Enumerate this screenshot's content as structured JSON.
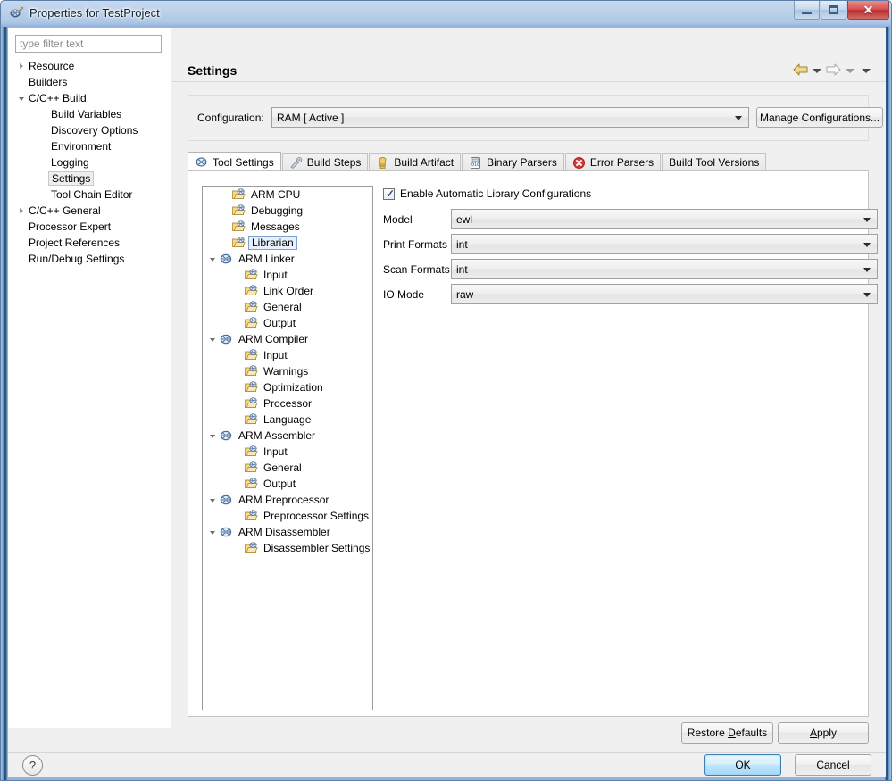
{
  "window": {
    "title": "Properties for TestProject",
    "icon": "eclipse-project-icon",
    "controls": {
      "minimize": "minimize-icon",
      "restore": "restore-icon",
      "close": "close-icon",
      "close_glyph": "✕"
    }
  },
  "filter": {
    "placeholder": "type filter text",
    "value": ""
  },
  "sidebar": {
    "items": [
      {
        "label": "Resource",
        "indent": 0,
        "arrow": "closed",
        "selected": false
      },
      {
        "label": "Builders",
        "indent": 0,
        "arrow": "none",
        "selected": false
      },
      {
        "label": "C/C++ Build",
        "indent": 0,
        "arrow": "open",
        "selected": false
      },
      {
        "label": "Build Variables",
        "indent": 1,
        "arrow": "none",
        "selected": false
      },
      {
        "label": "Discovery Options",
        "indent": 1,
        "arrow": "none",
        "selected": false
      },
      {
        "label": "Environment",
        "indent": 1,
        "arrow": "none",
        "selected": false
      },
      {
        "label": "Logging",
        "indent": 1,
        "arrow": "none",
        "selected": false
      },
      {
        "label": "Settings",
        "indent": 1,
        "arrow": "none",
        "selected": true
      },
      {
        "label": "Tool Chain Editor",
        "indent": 1,
        "arrow": "none",
        "selected": false
      },
      {
        "label": "C/C++ General",
        "indent": 0,
        "arrow": "closed",
        "selected": false
      },
      {
        "label": "Processor Expert",
        "indent": 0,
        "arrow": "none",
        "selected": false
      },
      {
        "label": "Project References",
        "indent": 0,
        "arrow": "none",
        "selected": false
      },
      {
        "label": "Run/Debug Settings",
        "indent": 0,
        "arrow": "none",
        "selected": false
      }
    ]
  },
  "header": {
    "title": "Settings",
    "back_icon": "back-arrow-icon",
    "forward_icon": "forward-arrow-icon",
    "menu_icon": "dropdown-caret-icon"
  },
  "configuration": {
    "label": "Configuration:",
    "value": "RAM  [ Active ]",
    "manage_button": "Manage Configurations..."
  },
  "tabs": [
    {
      "label": "Tool Settings",
      "icon": "tool-settings-icon",
      "active": true
    },
    {
      "label": "Build Steps",
      "icon": "build-steps-icon",
      "active": false
    },
    {
      "label": "Build Artifact",
      "icon": "build-artifact-icon",
      "active": false
    },
    {
      "label": "Binary Parsers",
      "icon": "binary-parsers-icon",
      "active": false
    },
    {
      "label": "Error Parsers",
      "icon": "error-parsers-icon",
      "active": false
    },
    {
      "label": "Build Tool Versions",
      "icon": "",
      "active": false
    }
  ],
  "tool_tree": [
    {
      "label": "ARM CPU",
      "indent": 1,
      "arrow": "none",
      "icon": "tool-folder-icon",
      "selected": false
    },
    {
      "label": "Debugging",
      "indent": 1,
      "arrow": "none",
      "icon": "tool-folder-icon",
      "selected": false
    },
    {
      "label": "Messages",
      "indent": 1,
      "arrow": "none",
      "icon": "tool-folder-icon",
      "selected": false
    },
    {
      "label": "Librarian",
      "indent": 1,
      "arrow": "none",
      "icon": "tool-folder-icon",
      "selected": true
    },
    {
      "label": "ARM Linker",
      "indent": 0,
      "arrow": "open",
      "icon": "tool-node-icon",
      "selected": false
    },
    {
      "label": "Input",
      "indent": 2,
      "arrow": "none",
      "icon": "tool-folder-icon",
      "selected": false
    },
    {
      "label": "Link Order",
      "indent": 2,
      "arrow": "none",
      "icon": "tool-folder-icon",
      "selected": false
    },
    {
      "label": "General",
      "indent": 2,
      "arrow": "none",
      "icon": "tool-folder-icon",
      "selected": false
    },
    {
      "label": "Output",
      "indent": 2,
      "arrow": "none",
      "icon": "tool-folder-icon",
      "selected": false
    },
    {
      "label": "ARM Compiler",
      "indent": 0,
      "arrow": "open",
      "icon": "tool-node-icon",
      "selected": false
    },
    {
      "label": "Input",
      "indent": 2,
      "arrow": "none",
      "icon": "tool-folder-icon",
      "selected": false
    },
    {
      "label": "Warnings",
      "indent": 2,
      "arrow": "none",
      "icon": "tool-folder-icon",
      "selected": false
    },
    {
      "label": "Optimization",
      "indent": 2,
      "arrow": "none",
      "icon": "tool-folder-icon",
      "selected": false
    },
    {
      "label": "Processor",
      "indent": 2,
      "arrow": "none",
      "icon": "tool-folder-icon",
      "selected": false
    },
    {
      "label": "Language",
      "indent": 2,
      "arrow": "none",
      "icon": "tool-folder-icon",
      "selected": false
    },
    {
      "label": "ARM Assembler",
      "indent": 0,
      "arrow": "open",
      "icon": "tool-node-icon",
      "selected": false
    },
    {
      "label": "Input",
      "indent": 2,
      "arrow": "none",
      "icon": "tool-folder-icon",
      "selected": false
    },
    {
      "label": "General",
      "indent": 2,
      "arrow": "none",
      "icon": "tool-folder-icon",
      "selected": false
    },
    {
      "label": "Output",
      "indent": 2,
      "arrow": "none",
      "icon": "tool-folder-icon",
      "selected": false
    },
    {
      "label": "ARM Preprocessor",
      "indent": 0,
      "arrow": "open",
      "icon": "tool-node-icon",
      "selected": false
    },
    {
      "label": "Preprocessor Settings",
      "indent": 2,
      "arrow": "none",
      "icon": "tool-folder-icon",
      "selected": false
    },
    {
      "label": "ARM Disassembler",
      "indent": 0,
      "arrow": "open",
      "icon": "tool-node-icon",
      "selected": false
    },
    {
      "label": "Disassembler Settings",
      "indent": 2,
      "arrow": "none",
      "icon": "tool-folder-icon",
      "selected": false
    }
  ],
  "form": {
    "enable_checkbox": {
      "label": "Enable Automatic Library Configurations",
      "checked": true,
      "tick": "✓"
    },
    "fields": [
      {
        "label": "Model",
        "value": "ewl"
      },
      {
        "label": "Print Formats",
        "value": "int"
      },
      {
        "label": "Scan Formats",
        "value": "int"
      },
      {
        "label": "IO Mode",
        "value": "raw"
      }
    ]
  },
  "buttons": {
    "restore_defaults_pre": "Restore ",
    "restore_defaults_mnemonic": "D",
    "restore_defaults_post": "efaults",
    "apply_mnemonic": "A",
    "apply_post": "pply",
    "ok": "OK",
    "cancel": "Cancel",
    "help": "?"
  },
  "colors": {
    "accent": "#3c7fb1",
    "selection": "#e8f0fb",
    "close_button": "#d9534f",
    "title_gradient_top": "#c8d9ef",
    "dialog_bg": "#f0f0f0"
  }
}
